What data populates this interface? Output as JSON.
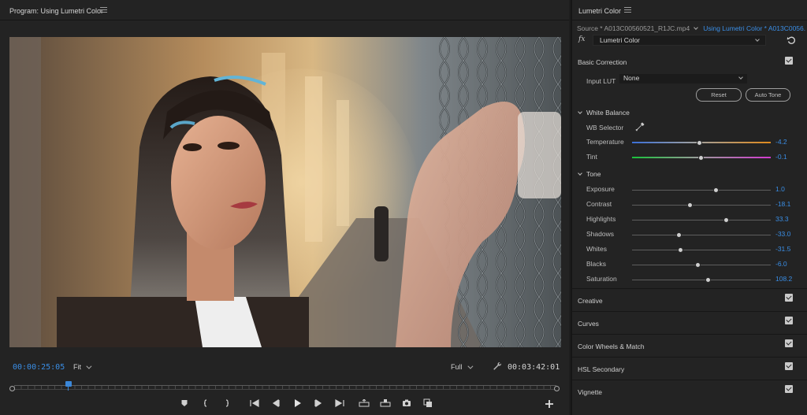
{
  "program": {
    "title": "Program: Using Lumetri Color",
    "current_time": "00:00:25:05",
    "fit_option": "Fit",
    "resolution_option": "Full",
    "duration": "00:03:42:01",
    "playhead_position_fraction": 0.1
  },
  "lumetri": {
    "title": "Lumetri Color",
    "source_clip": "Source * A013C00560521_R1JC.mp4",
    "sequence_clip": "Using Lumetri Color * A013C0056...",
    "fx_label": "fx",
    "effect_name": "Lumetri Color",
    "basic_correction": {
      "title": "Basic Correction",
      "enabled": true,
      "input_lut_label": "Input LUT",
      "input_lut_value": "None",
      "reset_label": "Reset",
      "auto_tone_label": "Auto Tone",
      "white_balance": {
        "title": "White Balance",
        "wb_selector_label": "WB Selector",
        "temperature": {
          "label": "Temperature",
          "value": "-4.2",
          "fraction": 0.49
        },
        "tint": {
          "label": "Tint",
          "value": "-0.1",
          "fraction": 0.5
        }
      },
      "tone": {
        "title": "Tone",
        "sliders": [
          {
            "label": "Exposure",
            "value": "1.0",
            "fraction": 0.61
          },
          {
            "label": "Contrast",
            "value": "-18.1",
            "fraction": 0.42
          },
          {
            "label": "Highlights",
            "value": "33.3",
            "fraction": 0.68
          },
          {
            "label": "Shadows",
            "value": "-33.0",
            "fraction": 0.34
          },
          {
            "label": "Whites",
            "value": "-31.5",
            "fraction": 0.35
          },
          {
            "label": "Blacks",
            "value": "-6.0",
            "fraction": 0.48
          },
          {
            "label": "Saturation",
            "value": "108.2",
            "fraction": 0.55
          }
        ]
      }
    },
    "sections": [
      {
        "title": "Creative",
        "enabled": true
      },
      {
        "title": "Curves",
        "enabled": true
      },
      {
        "title": "Color Wheels & Match",
        "enabled": true
      },
      {
        "title": "HSL Secondary",
        "enabled": true
      },
      {
        "title": "Vignette",
        "enabled": true
      }
    ]
  },
  "colors": {
    "accent_blue": "#3a8ee6",
    "panel_bg": "#232323"
  },
  "icons": [
    "hamburger-menu-icon",
    "chevron-down-icon",
    "wrench-icon",
    "marker-icon",
    "mark-in-icon",
    "mark-out-icon",
    "go-to-in-icon",
    "step-back-icon",
    "play-icon",
    "step-forward-icon",
    "go-to-out-icon",
    "lift-icon",
    "extract-icon",
    "export-frame-icon",
    "compare-view-icon",
    "add-button-icon",
    "reset-icon",
    "eyedropper-icon",
    "checkbox-icon"
  ]
}
